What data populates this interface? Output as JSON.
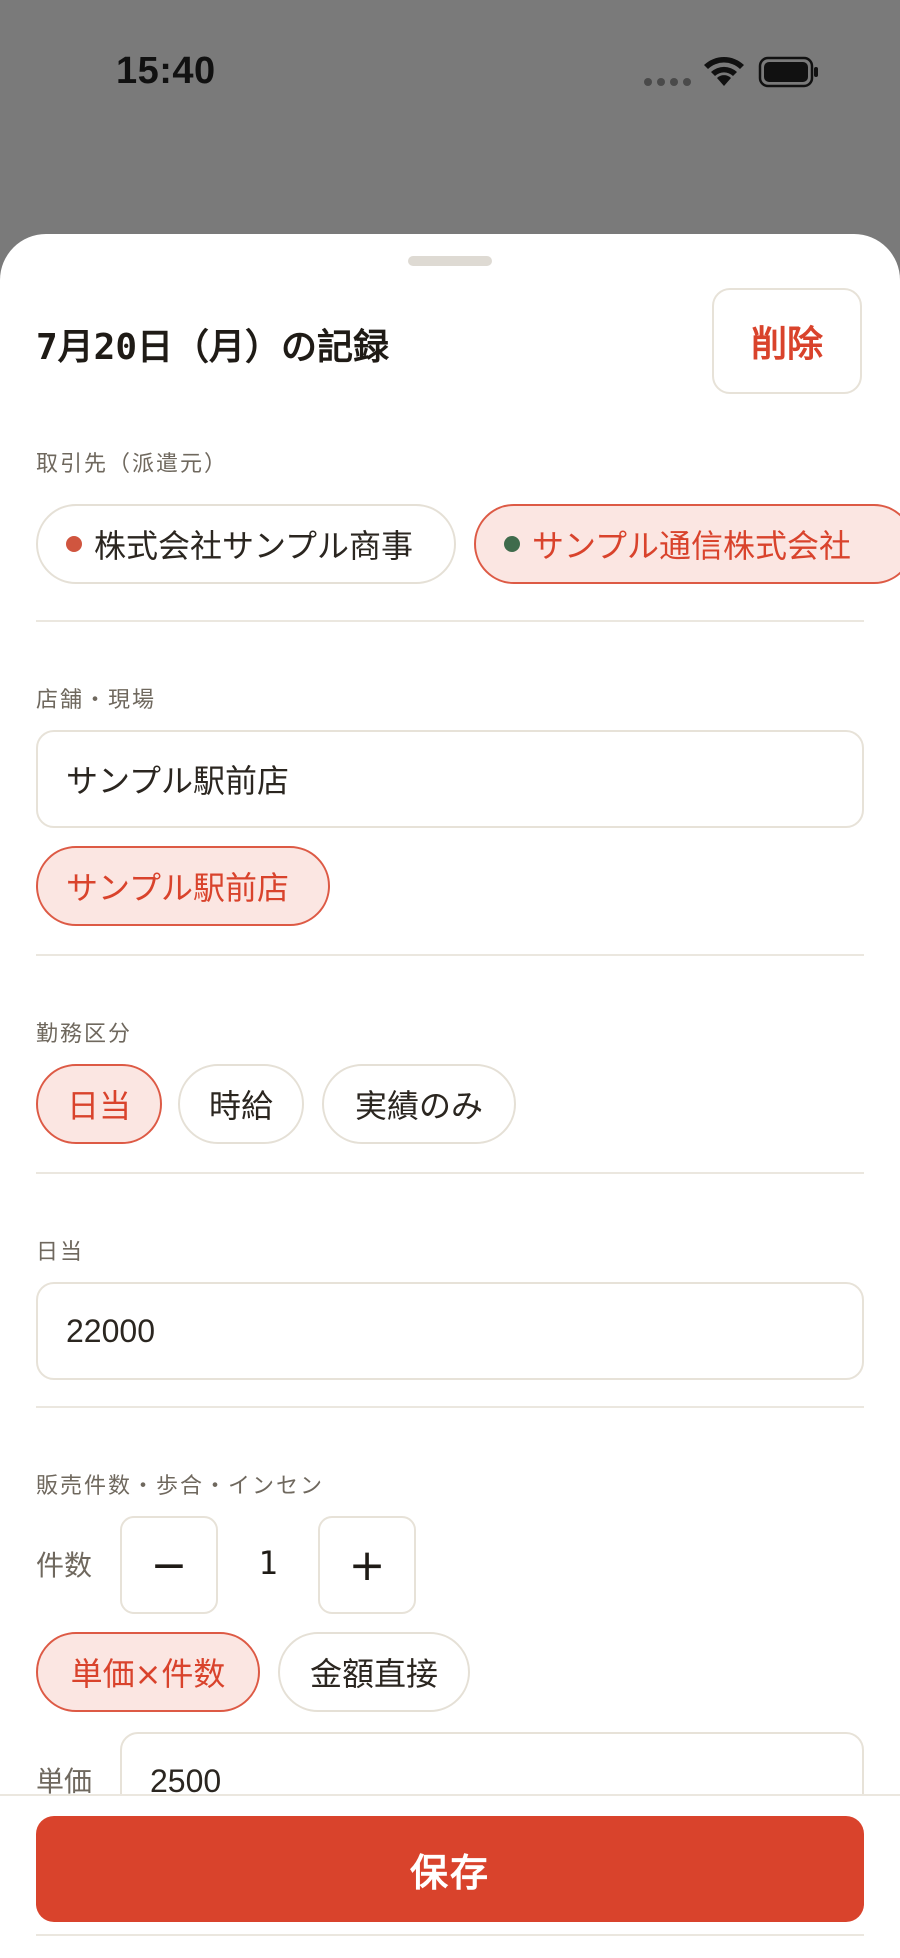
{
  "status_bar": {
    "time": "15:40"
  },
  "sheet": {
    "title": "7月20日（月）の記録",
    "delete_label": "削除"
  },
  "client": {
    "label": "取引先（派遣元）",
    "options": [
      {
        "name": "株式会社サンプル商事",
        "dot_color": "#d0553f",
        "selected": false
      },
      {
        "name": "サンプル通信株式会社",
        "dot_color": "#3f6b4c",
        "selected": true
      }
    ]
  },
  "store": {
    "label": "店舗・現場",
    "value": "サンプル駅前店",
    "suggestion": "サンプル駅前店"
  },
  "work_type": {
    "label": "勤務区分",
    "options": [
      {
        "label": "日当",
        "selected": true
      },
      {
        "label": "時給",
        "selected": false
      },
      {
        "label": "実績のみ",
        "selected": false
      }
    ]
  },
  "daily_wage": {
    "label": "日当",
    "value": "22000"
  },
  "sales": {
    "label": "販売件数・歩合・インセン",
    "count_label": "件数",
    "count_value": "1",
    "minus_label": "−",
    "plus_label": "+",
    "mode_options": [
      {
        "label": "単価×件数",
        "selected": true
      },
      {
        "label": "金額直接",
        "selected": false
      }
    ],
    "unit_price_label": "単価",
    "unit_price_value": "2500"
  },
  "footer": {
    "save_label": "保存"
  },
  "colors": {
    "accent": "#d9432c",
    "selected_bg": "#fbe6e2",
    "backdrop": "#7a7a7a"
  }
}
